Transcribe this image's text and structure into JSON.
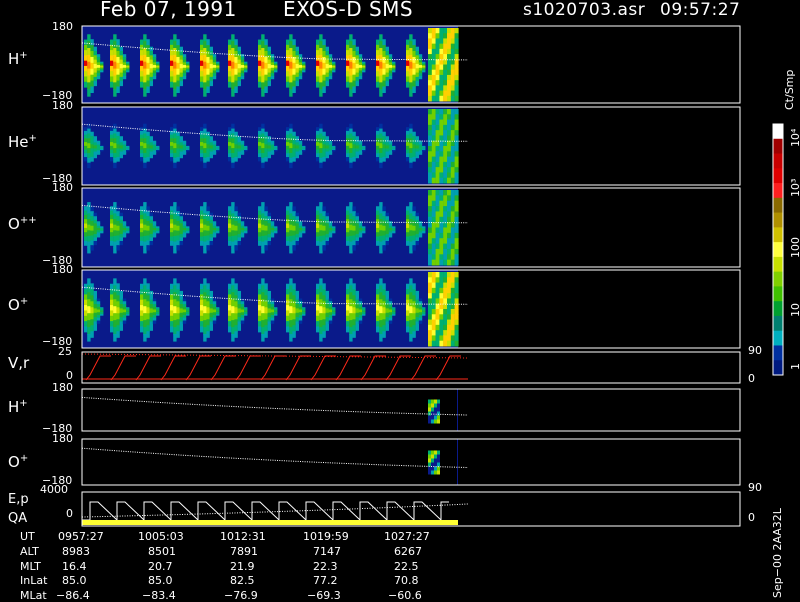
{
  "header": {
    "date": "Feb 07, 1991",
    "instrument": "EXOS-D SMS",
    "file": "s1020703.asr",
    "time": "09:57:27"
  },
  "colors": {
    "background": "#000000",
    "panel_bg": "#0a1a8a",
    "axis": "#ffffff",
    "rv_trace": "#ff2a1a",
    "qa_bar": "#ffff33"
  },
  "panels": [
    {
      "name": "H+",
      "label": "H",
      "charge": "+",
      "ytop": "180",
      "ybot": "−180"
    },
    {
      "name": "He+",
      "label": "He",
      "charge": "+",
      "ytop": "180",
      "ybot": "−180"
    },
    {
      "name": "O++",
      "label": "O",
      "charge": "++",
      "ytop": "180",
      "ybot": "−180"
    },
    {
      "name": "O+",
      "label": "O",
      "charge": "+",
      "ytop": "180",
      "ybot": "−180"
    },
    {
      "name": "V,r",
      "label": "V,r",
      "charge": "",
      "ytop": "25",
      "ybot": "0",
      "rtop": "90",
      "rbot": "0"
    },
    {
      "name": "H+ (2)",
      "label": "H",
      "charge": "+",
      "ytop": "180",
      "ybot": "−180"
    },
    {
      "name": "O+ (2)",
      "label": "O",
      "charge": "+",
      "ytop": "180",
      "ybot": "−180"
    },
    {
      "name": "E,p QA",
      "label": "E,p",
      "label2": "QA",
      "charge": "",
      "ytop": "4000",
      "ybot": "0",
      "rtop": "90",
      "rbot": "0"
    }
  ],
  "colorbar": {
    "unit": "Ct/Smp",
    "ticks": [
      "10⁴",
      "10³",
      "100",
      "10",
      "1"
    ],
    "colors": [
      "#ffffff",
      "#a00000",
      "#c80000",
      "#e00000",
      "#ff2020",
      "#8a6a00",
      "#b09000",
      "#d0c000",
      "#ffff40",
      "#c8e000",
      "#80d000",
      "#40c000",
      "#00a030",
      "#008070",
      "#00b0c0",
      "#0030a0",
      "#001a80"
    ]
  },
  "ephemeris": {
    "labels": [
      "UT",
      "ALT",
      "MLT",
      "InLat",
      "MLat"
    ],
    "columns": [
      [
        "0957:27",
        "8983",
        "16.4",
        "85.0",
        "−86.4"
      ],
      [
        "1005:03",
        "8501",
        "20.7",
        "85.0",
        "−83.4"
      ],
      [
        "1012:31",
        "7891",
        "21.9",
        "82.5",
        "−76.9"
      ],
      [
        "1019:59",
        "7147",
        "22.3",
        "77.2",
        "−69.3"
      ],
      [
        "1027:27",
        "6267",
        "22.5",
        "70.8",
        "−60.6"
      ]
    ]
  },
  "footer": {
    "tag": "Sep−00  2AA32L"
  },
  "chart_data": {
    "type": "heatmap",
    "title": "Feb 07, 1991   EXOS-D SMS",
    "x": [
      "0957:27",
      "1005:03",
      "1012:31",
      "1019:59",
      "1027:27"
    ],
    "series": [
      {
        "name": "H+",
        "yrange": [
          -180,
          180
        ]
      },
      {
        "name": "He+",
        "yrange": [
          -180,
          180
        ]
      },
      {
        "name": "O++",
        "yrange": [
          -180,
          180
        ]
      },
      {
        "name": "O+",
        "yrange": [
          -180,
          180
        ]
      },
      {
        "name": "V,r",
        "yrange": [
          0,
          25
        ]
      },
      {
        "name": "H+",
        "yrange": [
          -180,
          180
        ]
      },
      {
        "name": "O+",
        "yrange": [
          -180,
          180
        ]
      },
      {
        "name": "E,p",
        "yrange": [
          0,
          4000
        ]
      }
    ],
    "color_scale": "log",
    "zlim": [
      1,
      10000
    ],
    "zlabel": "Ct/Smp"
  }
}
